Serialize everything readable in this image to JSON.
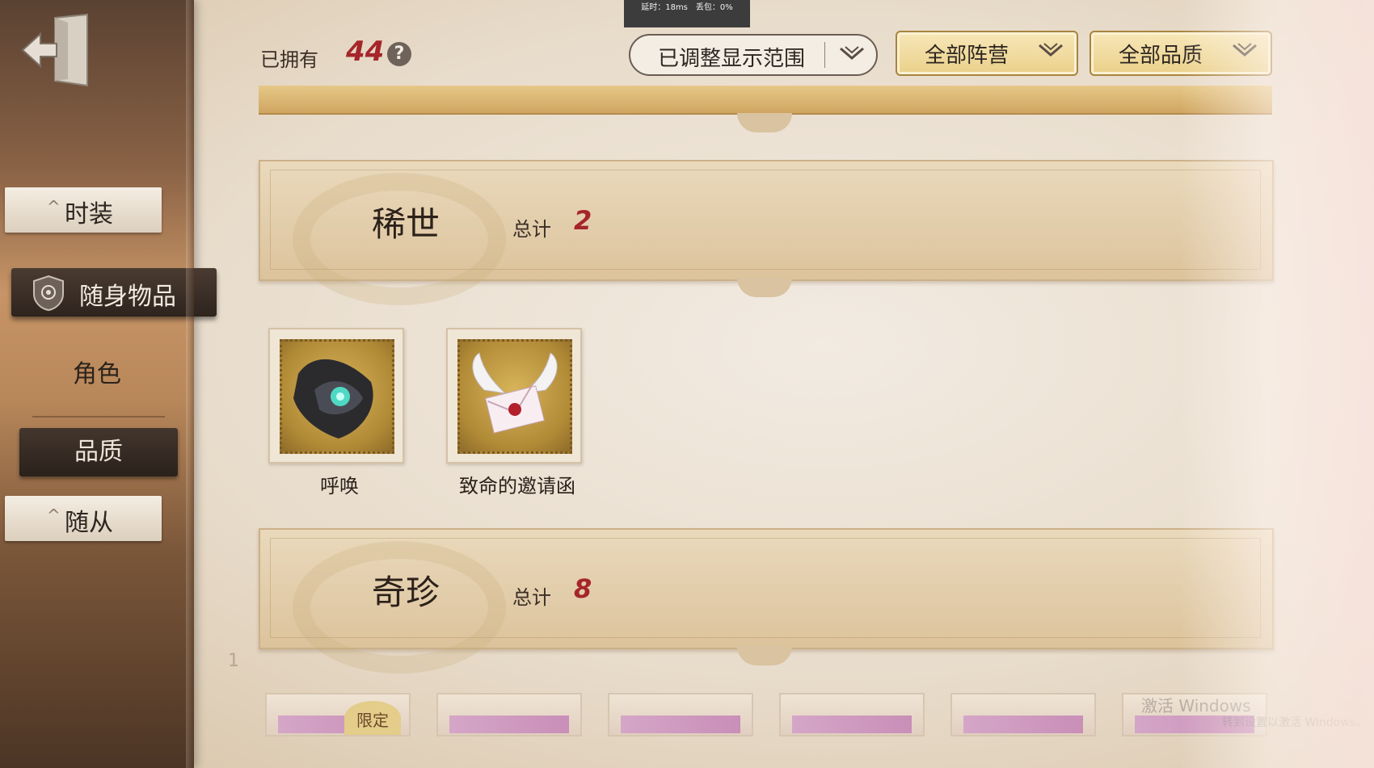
{
  "status": {
    "latency_text": "延时：18ms　丢包：0%"
  },
  "sidebar": {
    "items": [
      {
        "label": "时装"
      },
      {
        "label": "随身物品"
      },
      {
        "label": "角色"
      },
      {
        "label": "品质"
      },
      {
        "label": "随从"
      }
    ]
  },
  "header": {
    "owned_label": "已拥有",
    "owned_count": "44",
    "help_symbol": "?",
    "range_dropdown": "已调整显示范围",
    "camp_dropdown": "全部阵营",
    "quality_dropdown": "全部品质"
  },
  "sections": [
    {
      "title": "稀世",
      "total_label": "总计",
      "total": "2",
      "items": [
        {
          "name": "呼唤",
          "icon": "dark-crystal-icon"
        },
        {
          "name": "致命的邀请函",
          "icon": "winged-letter-icon"
        }
      ]
    },
    {
      "title": "奇珍",
      "total_label": "总计",
      "total": "8",
      "limited_label": "限定"
    }
  ],
  "watermark": {
    "line1": "激活 Windows",
    "line2": "转到设置以激活 Windows。"
  },
  "colors": {
    "accent_red": "#a5262a",
    "gold": "#ead08a",
    "sidebar_dark": "#2e241e"
  }
}
